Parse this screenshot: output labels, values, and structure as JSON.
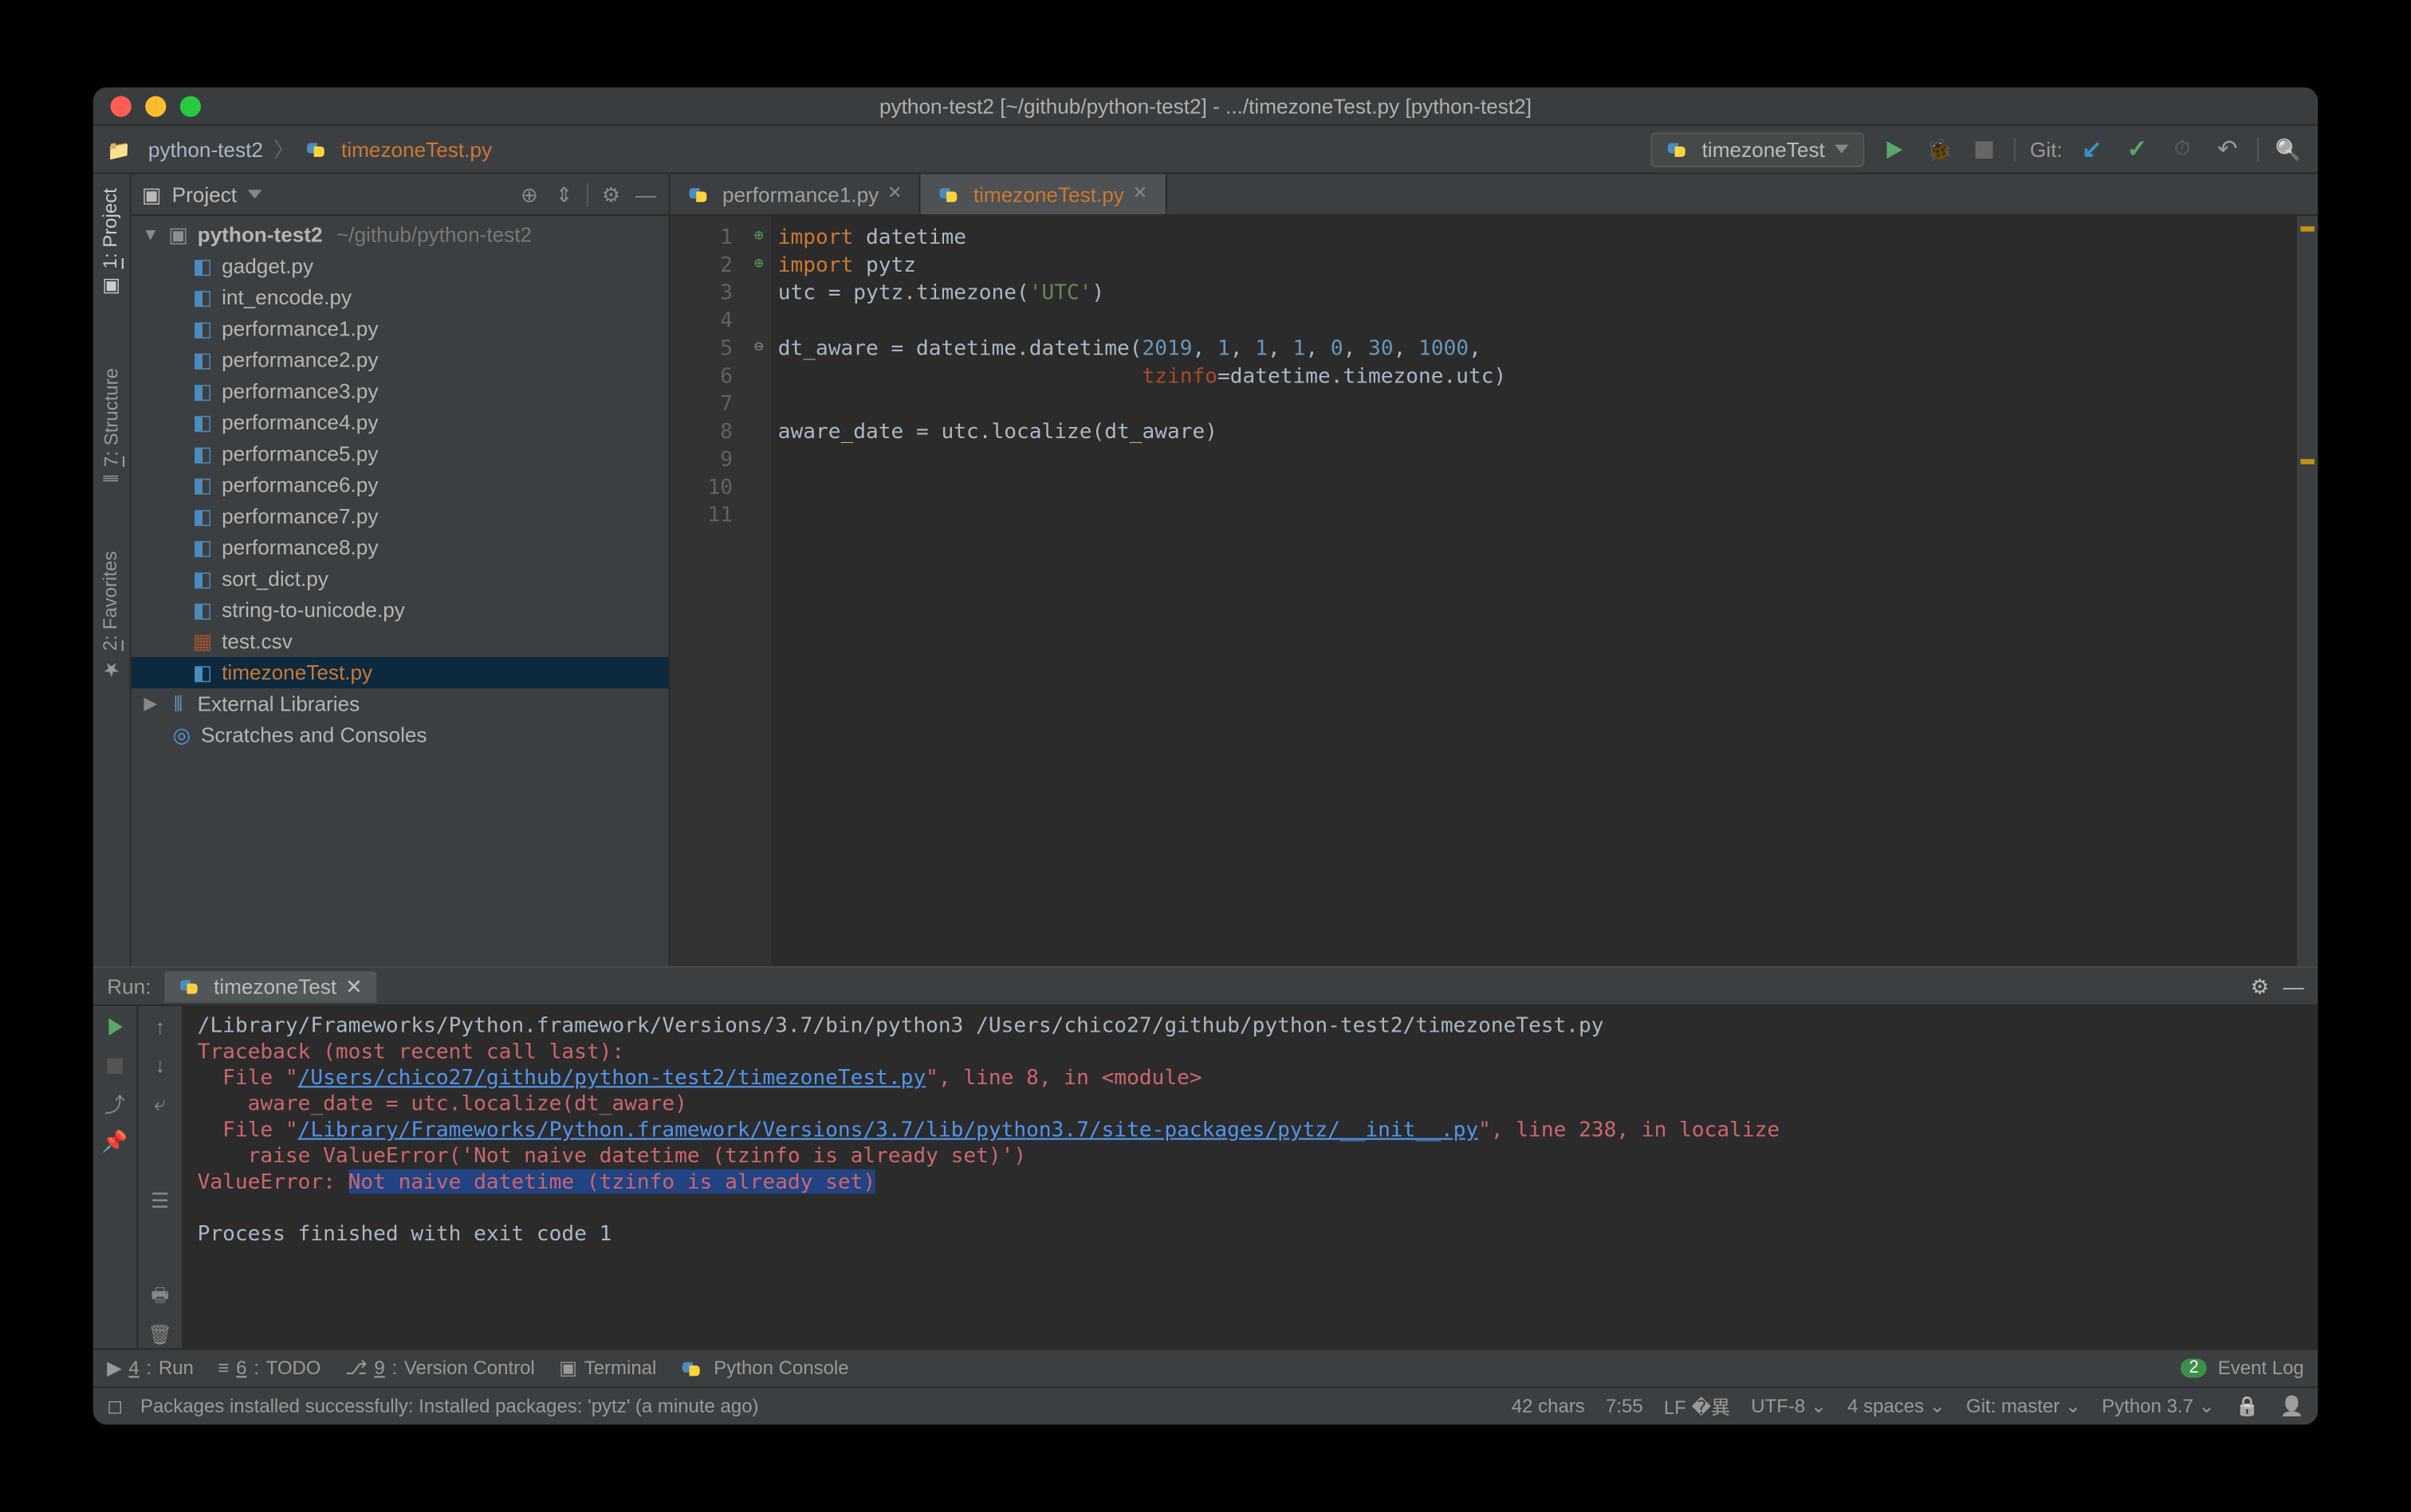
{
  "titlebar": {
    "title": "python-test2 [~/github/python-test2] - .../timezoneTest.py [python-test2]"
  },
  "breadcrumb": {
    "root": "python-test2",
    "file": "timezoneTest.py"
  },
  "runconfig": {
    "name": "timezoneTest"
  },
  "git_label": "Git:",
  "left_tabs": {
    "project_num": "1",
    "project": "Project",
    "structure_num": "7",
    "structure": "Structure",
    "favorites_num": "2",
    "favorites": "Favorites"
  },
  "project_panel": {
    "title": "Project"
  },
  "tree": {
    "root": {
      "name": "python-test2",
      "path": "~/github/python-test2"
    },
    "files": [
      "gadget.py",
      "int_encode.py",
      "performance1.py",
      "performance2.py",
      "performance3.py",
      "performance4.py",
      "performance5.py",
      "performance6.py",
      "performance7.py",
      "performance8.py",
      "sort_dict.py",
      "string-to-unicode.py",
      "test.csv",
      "timezoneTest.py"
    ],
    "external": "External Libraries",
    "scratches": "Scratches and Consoles"
  },
  "tabs": {
    "inactive": "performance1.py",
    "active": "timezoneTest.py"
  },
  "code": {
    "lines": [
      "1",
      "2",
      "3",
      "4",
      "5",
      "6",
      "7",
      "8",
      "9",
      "10",
      "11"
    ],
    "l1_kw": "import",
    "l1_rest": " datetime",
    "l2_kw": "import",
    "l2_rest": " pytz",
    "l3_a": "utc = pytz.timezone(",
    "l3_str": "'UTC'",
    "l3_b": ")",
    "l5_a": "dt_aware = datetime.datetime(",
    "l5_n1": "2019",
    "l5_c": ", ",
    "l5_n2": "1",
    "l5_n3": "1",
    "l5_n4": "1",
    "l5_n5": "0",
    "l5_n6": "30",
    "l5_n7": "1000",
    "l5_end": ",",
    "l6_pad": "                             ",
    "l6_param": "tzinfo",
    "l6_rest": "=datetime.timezone.utc)",
    "l8": "aware_date = utc.localize(dt_aware)"
  },
  "run": {
    "label": "Run:",
    "tab": "timezoneTest",
    "out1": "/Library/Frameworks/Python.framework/Versions/3.7/bin/python3 /Users/chico27/github/python-test2/timezoneTest.py",
    "tb": "Traceback (most recent call last):",
    "f1a": "  File \"",
    "f1link": "/Users/chico27/github/python-test2/timezoneTest.py",
    "f1b": "\", line 8, in <module>",
    "f1c": "    aware_date = utc.localize(dt_aware)",
    "f2a": "  File \"",
    "f2link": "/Library/Frameworks/Python.framework/Versions/3.7/lib/python3.7/site-packages/pytz/__init__.py",
    "f2b": "\", line 238, in localize",
    "f2c": "    raise ValueError('Not naive datetime (tzinfo is already set)')",
    "err_a": "ValueError: ",
    "err_sel": "Not naive datetime (tzinfo is already set)",
    "exit": "Process finished with exit code 1"
  },
  "bottom": {
    "run_num": "4",
    "run": "Run",
    "todo_num": "6",
    "todo": "TODO",
    "vc_num": "9",
    "vc": "Version Control",
    "term": "Terminal",
    "pycon": "Python Console",
    "eventlog": "Event Log",
    "event_badge": "2"
  },
  "status": {
    "msg": "Packages installed successfully: Installed packages: 'pytz' (a minute ago)",
    "chars": "42 chars",
    "pos": "7:55",
    "lf": "LF",
    "enc": "UTF-8",
    "indent": "4 spaces",
    "git": "Git: master",
    "py": "Python 3.7"
  }
}
